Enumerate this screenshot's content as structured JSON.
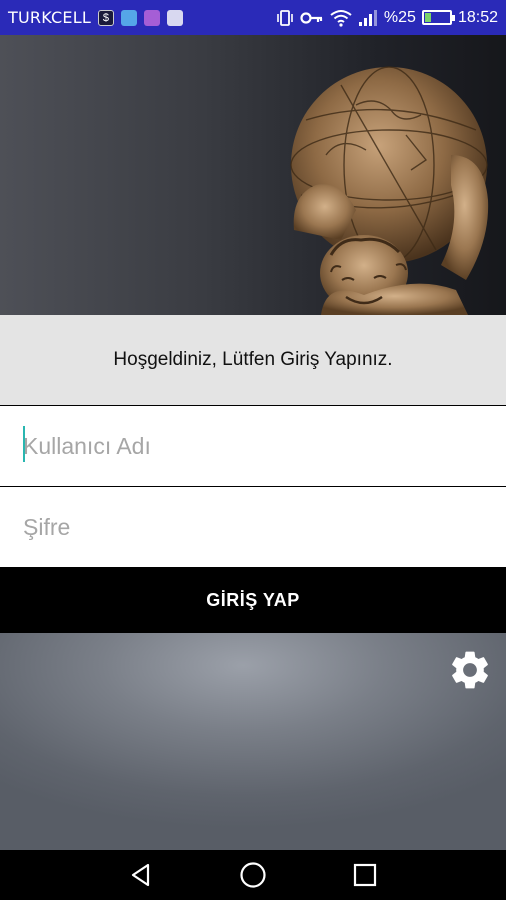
{
  "status_bar": {
    "carrier": "TURKCELL",
    "battery_text": "%25",
    "time": "18:52",
    "battery_level": 0.25,
    "icons": [
      "notification-s-icon",
      "notification-cloud-icon",
      "notification-app-icon",
      "notification-square-icon",
      "vibrate-icon",
      "key-icon",
      "wifi-icon",
      "signal-icon",
      "battery-charging-icon"
    ]
  },
  "hero": {
    "image": "atlas-statue-holding-globe"
  },
  "welcome": {
    "text": "Hoşgeldiniz, Lütfen Giriş Yapınız."
  },
  "form": {
    "username_placeholder": "Kullanıcı Adı",
    "username_value": "",
    "password_placeholder": "Şifre",
    "password_value": "",
    "login_label": "GİRİŞ YAP"
  },
  "settings": {
    "icon": "gear-icon"
  },
  "nav": {
    "back": "back-icon",
    "home": "home-icon",
    "recents": "recents-icon"
  },
  "colors": {
    "status_bar": "#2a2ab8",
    "welcome_bg": "#e4e4e4",
    "button_bg": "#000000",
    "cursor": "#29b6b0"
  }
}
